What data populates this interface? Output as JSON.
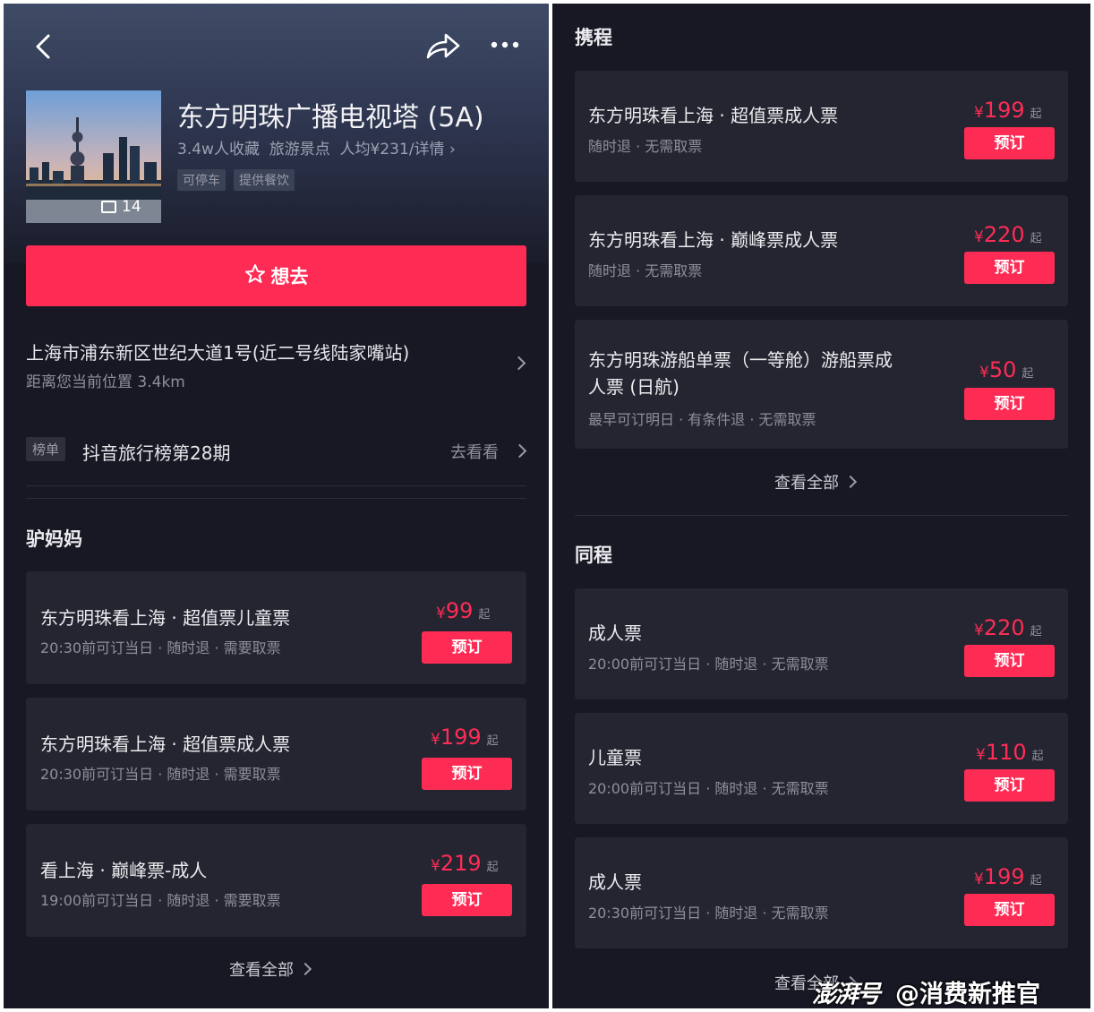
{
  "left": {
    "attraction": {
      "title": "东方明珠广播电视塔 (5A)",
      "meta": "3.4w人收藏  旅游景点  人均¥231/详情 ›",
      "tags": [
        "可停车",
        "提供餐饮"
      ],
      "photo_count": "14"
    },
    "want_button": "想去",
    "address": {
      "line": "上海市浦东新区世纪大道1号(近二号线陆家嘴站)",
      "distance": "距离您当前位置 3.4km"
    },
    "ranking": {
      "badge": "榜单",
      "name": "抖音旅行榜第28期",
      "link": "去看看"
    },
    "section": {
      "title": "驴妈妈",
      "tickets": [
        {
          "name": "东方明珠看上海 · 超值票儿童票",
          "sub": "20:30前可订当日 · 随时退 · 需要取票",
          "currency": "¥",
          "price": "99",
          "qi": "起",
          "book": "预订"
        },
        {
          "name": "东方明珠看上海 · 超值票成人票",
          "sub": "20:30前可订当日 · 随时退 · 需要取票",
          "currency": "¥",
          "price": "199",
          "qi": "起",
          "book": "预订"
        },
        {
          "name": "看上海 · 巅峰票-成人",
          "sub": "19:00前可订当日 · 随时退 · 需要取票",
          "currency": "¥",
          "price": "219",
          "qi": "起",
          "book": "预订"
        }
      ],
      "view_all": "查看全部"
    }
  },
  "right": {
    "ctrip": {
      "title": "携程",
      "tickets": [
        {
          "name": "东方明珠看上海 · 超值票成人票",
          "sub": "随时退 · 无需取票",
          "currency": "¥",
          "price": "199",
          "qi": "起",
          "book": "预订"
        },
        {
          "name": "东方明珠看上海 · 巅峰票成人票",
          "sub": "随时退 · 无需取票",
          "currency": "¥",
          "price": "220",
          "qi": "起",
          "book": "预订"
        },
        {
          "name_line1": "东方明珠游船单票（一等舱）游船票成",
          "name_line2": "人票 (日航)",
          "sub": "最早可订明日 · 有条件退 · 无需取票",
          "currency": "¥",
          "price": "50",
          "qi": "起",
          "book": "预订"
        }
      ],
      "view_all": "查看全部"
    },
    "tongcheng": {
      "title": "同程",
      "tickets": [
        {
          "name": "成人票",
          "sub": "20:00前可订当日 · 随时退 · 无需取票",
          "currency": "¥",
          "price": "220",
          "qi": "起",
          "book": "预订"
        },
        {
          "name": "儿童票",
          "sub": "20:00前可订当日 · 随时退 · 无需取票",
          "currency": "¥",
          "price": "110",
          "qi": "起",
          "book": "预订"
        },
        {
          "name": "成人票",
          "sub": "20:30前可订当日 · 随时退 · 无需取票",
          "currency": "¥",
          "price": "199",
          "qi": "起",
          "book": "预订"
        }
      ],
      "view_all": "查看全部"
    }
  },
  "watermark": {
    "logo": "澎湃号",
    "handle": "@消费新推官"
  },
  "colors": {
    "accent": "#fe2c55",
    "background": "#171824",
    "card": "#242531"
  }
}
